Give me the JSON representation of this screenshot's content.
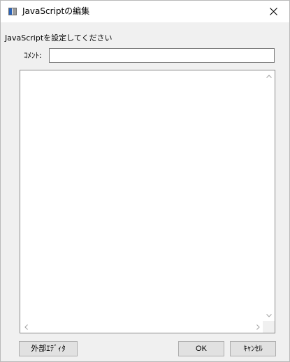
{
  "window": {
    "title": "JavaScriptの編集",
    "icon": "app-window-icon",
    "close_glyph": "✕"
  },
  "prompt": "JavaScriptを設定してください",
  "comment": {
    "label": "ｺﾒﾝﾄ:",
    "value": "",
    "placeholder": ""
  },
  "editor": {
    "content": ""
  },
  "buttons": {
    "external_editor": "外部ｴﾃﾞｨﾀ",
    "ok": "OK",
    "cancel": "ｷｬﾝｾﾙ"
  },
  "colors": {
    "dialog_bg": "#f0f0f0",
    "title_bg": "#ffffff",
    "button_bg": "#e1e1e1",
    "border": "#adadad"
  }
}
